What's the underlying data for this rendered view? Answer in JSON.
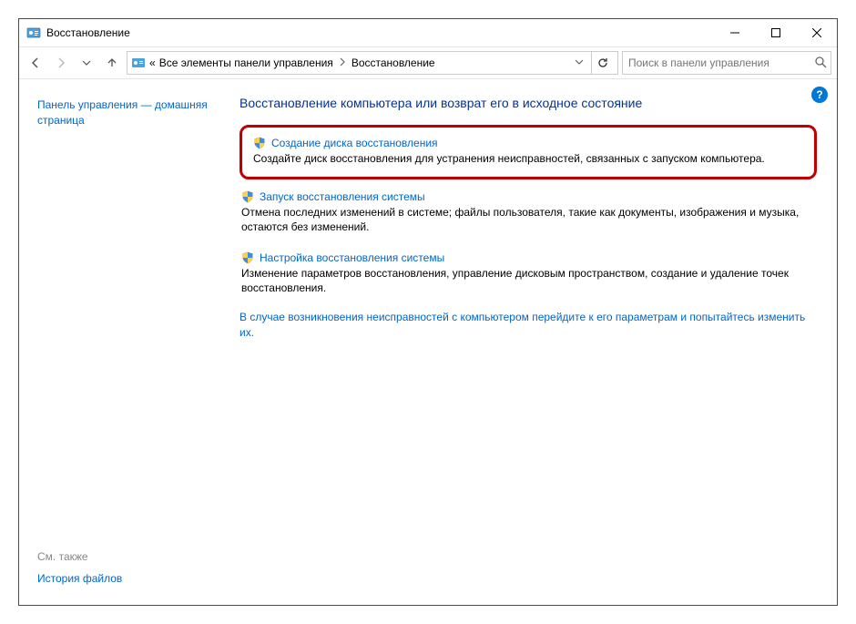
{
  "window": {
    "title": "Восстановление"
  },
  "address": {
    "prefix": "«",
    "crumb1": "Все элементы панели управления",
    "crumb2": "Восстановление"
  },
  "search": {
    "placeholder": "Поиск в панели управления"
  },
  "left": {
    "home_link": "Панель управления — домашняя страница",
    "see_also": "См. также",
    "file_history": "История файлов"
  },
  "main": {
    "heading": "Восстановление компьютера или возврат его в исходное состояние",
    "items": [
      {
        "title": "Создание диска восстановления",
        "desc": "Создайте диск восстановления для устранения неисправностей, связанных с запуском компьютера."
      },
      {
        "title": "Запуск восстановления системы",
        "desc": "Отмена последних изменений в системе; файлы пользователя, такие как документы, изображения и музыка, остаются без изменений."
      },
      {
        "title": "Настройка восстановления системы",
        "desc": "Изменение параметров восстановления, управление дисковым пространством, создание и удаление точек восстановления."
      }
    ],
    "footer_link": "В случае возникновения неисправностей с компьютером перейдите к его параметрам и попытайтесь изменить их."
  },
  "help": "?"
}
